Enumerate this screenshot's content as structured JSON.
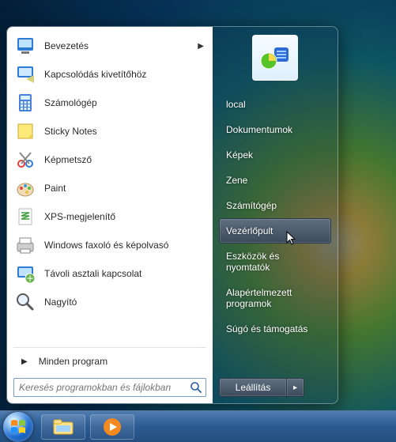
{
  "left_programs": [
    {
      "label": "Bevezetés",
      "icon": "getting-started-icon",
      "has_submenu": true
    },
    {
      "label": "Kapcsolódás kivetítőhöz",
      "icon": "projector-icon",
      "has_submenu": false
    },
    {
      "label": "Számológép",
      "icon": "calculator-icon",
      "has_submenu": false
    },
    {
      "label": "Sticky Notes",
      "icon": "sticky-notes-icon",
      "has_submenu": false
    },
    {
      "label": "Képmetsző",
      "icon": "snipping-tool-icon",
      "has_submenu": false
    },
    {
      "label": "Paint",
      "icon": "paint-icon",
      "has_submenu": false
    },
    {
      "label": "XPS-megjelenítő",
      "icon": "xps-viewer-icon",
      "has_submenu": false
    },
    {
      "label": "Windows faxoló és képolvasó",
      "icon": "fax-scan-icon",
      "has_submenu": false
    },
    {
      "label": "Távoli asztali kapcsolat",
      "icon": "remote-desktop-icon",
      "has_submenu": false
    },
    {
      "label": "Nagyító",
      "icon": "magnifier-icon",
      "has_submenu": false
    }
  ],
  "all_programs_label": "Minden program",
  "search_placeholder": "Keresés programokban és fájlokban",
  "right_items": [
    {
      "label": "local",
      "hover": false
    },
    {
      "label": "Dokumentumok",
      "hover": false
    },
    {
      "label": "Képek",
      "hover": false
    },
    {
      "label": "Zene",
      "hover": false
    },
    {
      "label": "Számítógép",
      "hover": false
    },
    {
      "label": "Vezérlőpult",
      "hover": true
    },
    {
      "label": "Eszközök és nyomtatók",
      "hover": false
    },
    {
      "label": "Alapértelmezett programok",
      "hover": false
    },
    {
      "label": "Súgó és támogatás",
      "hover": false
    }
  ],
  "shutdown_label": "Leállítás",
  "user_picture_icon": "control-panel-icon",
  "taskbar_items": [
    {
      "name": "explorer-icon"
    },
    {
      "name": "media-player-icon"
    }
  ]
}
